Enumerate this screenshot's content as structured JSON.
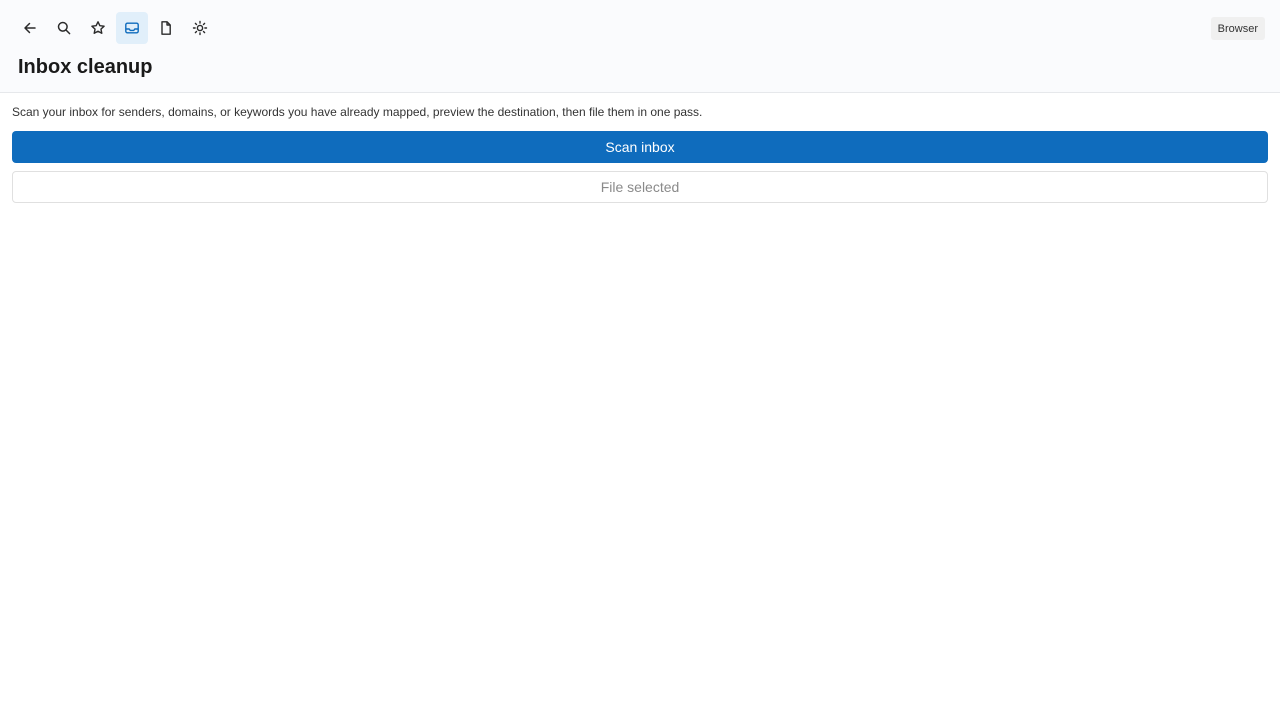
{
  "toolbar": {
    "items": [
      {
        "icon": "back-arrow-icon",
        "active": false
      },
      {
        "icon": "search-icon",
        "active": false
      },
      {
        "icon": "star-icon",
        "active": false
      },
      {
        "icon": "mail-icon",
        "active": true
      },
      {
        "icon": "document-icon",
        "active": false
      },
      {
        "icon": "sun-icon",
        "active": false
      }
    ]
  },
  "header": {
    "badge": "Browser",
    "title": "Inbox cleanup"
  },
  "main": {
    "description": "Scan your inbox for senders, domains, or keywords you have already mapped, preview the destination, then file them in one pass.",
    "scan_label": "Scan inbox",
    "file_label": "File selected",
    "file_disabled": true
  },
  "colors": {
    "accent": "#0f6cbd",
    "active_bg": "#e1effa",
    "header_bg": "#fafbfd"
  }
}
